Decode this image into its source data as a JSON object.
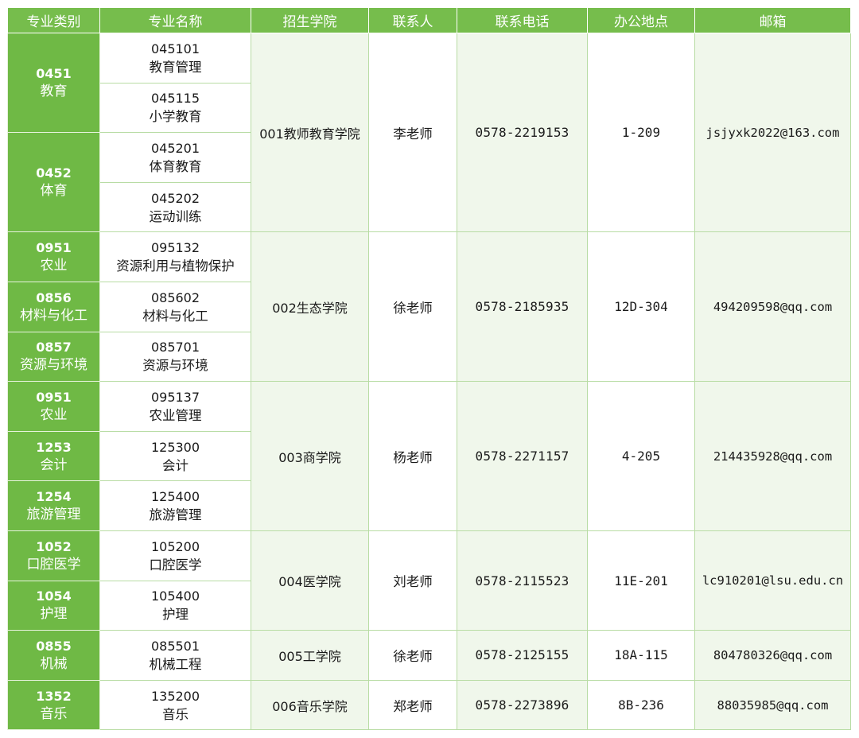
{
  "headers": [
    "专业类别",
    "专业名称",
    "招生学院",
    "联系人",
    "联系电话",
    "办公地点",
    "邮箱"
  ],
  "groups": [
    {
      "college": "001教师教育学院",
      "contact": "李老师",
      "phone": "0578-2219153",
      "office": "1-209",
      "email": "jsjyxk2022@163.com",
      "categories": [
        {
          "code": "0451",
          "name": "教育",
          "majors": [
            {
              "code": "045101",
              "name": "教育管理"
            },
            {
              "code": "045115",
              "name": "小学教育"
            }
          ]
        },
        {
          "code": "0452",
          "name": "体育",
          "majors": [
            {
              "code": "045201",
              "name": "体育教育"
            },
            {
              "code": "045202",
              "name": "运动训练"
            }
          ]
        }
      ]
    },
    {
      "college": "002生态学院",
      "contact": "徐老师",
      "phone": "0578-2185935",
      "office": "12D-304",
      "email": "494209598@qq.com",
      "categories": [
        {
          "code": "0951",
          "name": "农业",
          "majors": [
            {
              "code": "095132",
              "name": "资源利用与植物保护"
            }
          ]
        },
        {
          "code": "0856",
          "name": "材料与化工",
          "majors": [
            {
              "code": "085602",
              "name": "材料与化工"
            }
          ]
        },
        {
          "code": "0857",
          "name": "资源与环境",
          "majors": [
            {
              "code": "085701",
              "name": "资源与环境"
            }
          ]
        }
      ]
    },
    {
      "college": "003商学院",
      "contact": "杨老师",
      "phone": "0578-2271157",
      "office": "4-205",
      "email": "214435928@qq.com",
      "categories": [
        {
          "code": "0951",
          "name": "农业",
          "majors": [
            {
              "code": "095137",
              "name": "农业管理"
            }
          ]
        },
        {
          "code": "1253",
          "name": "会计",
          "majors": [
            {
              "code": "125300",
              "name": "会计"
            }
          ]
        },
        {
          "code": "1254",
          "name": "旅游管理",
          "majors": [
            {
              "code": "125400",
              "name": "旅游管理"
            }
          ]
        }
      ]
    },
    {
      "college": "004医学院",
      "contact": "刘老师",
      "phone": "0578-2115523",
      "office": "11E-201",
      "email": "lc910201@lsu.edu.cn",
      "categories": [
        {
          "code": "1052",
          "name": "口腔医学",
          "majors": [
            {
              "code": "105200",
              "name": "口腔医学"
            }
          ]
        },
        {
          "code": "1054",
          "name": "护理",
          "majors": [
            {
              "code": "105400",
              "name": "护理"
            }
          ]
        }
      ]
    },
    {
      "college": "005工学院",
      "contact": "徐老师",
      "phone": "0578-2125155",
      "office": "18A-115",
      "email": "804780326@qq.com",
      "categories": [
        {
          "code": "0855",
          "name": "机械",
          "majors": [
            {
              "code": "085501",
              "name": "机械工程"
            }
          ]
        }
      ]
    },
    {
      "college": "006音乐学院",
      "contact": "郑老师",
      "phone": "0578-2273896",
      "office": "8B-236",
      "email": "88035985@qq.com",
      "categories": [
        {
          "code": "1352",
          "name": "音乐",
          "majors": [
            {
              "code": "135200",
              "name": "音乐"
            }
          ]
        }
      ]
    }
  ],
  "colors": {
    "header_bg": "#76bd4c",
    "category_bg": "#6fb945",
    "band_bg": "#f0f7eb",
    "border": "#b8dca4"
  }
}
